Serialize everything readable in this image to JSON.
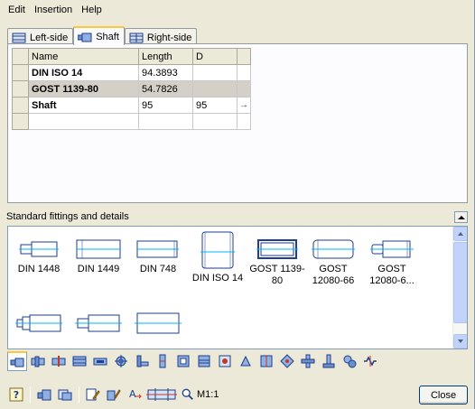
{
  "menu": [
    "Edit",
    "Insertion",
    "Help"
  ],
  "tabs": [
    {
      "label": "Left-side",
      "icon": "left-side-icon",
      "active": false
    },
    {
      "label": "Shaft",
      "icon": "shaft-icon",
      "active": true
    },
    {
      "label": "Right-side",
      "icon": "right-side-icon",
      "active": false
    }
  ],
  "table": {
    "columns": [
      "Name",
      "Length",
      "D"
    ],
    "rows": [
      {
        "name": "DIN ISO 14",
        "length": "94.3893",
        "d": ""
      },
      {
        "name": "GOST 1139-80",
        "length": "54.7826",
        "d": ""
      },
      {
        "name": "Shaft",
        "length": "95",
        "d": "95"
      },
      {
        "name": "",
        "length": "",
        "d": ""
      }
    ],
    "selected_row": 1,
    "row_arrow": "→"
  },
  "fittings": {
    "title": "Standard fittings and details",
    "items": [
      {
        "label": "DIN 1448",
        "icon": "stepped-shaft-icon"
      },
      {
        "label": "DIN 1449",
        "icon": "conical-shaft-icon"
      },
      {
        "label": "DIN 748",
        "icon": "cylinder-shaft-icon"
      },
      {
        "label": "DIN ISO 14",
        "icon": "spline-shaft-icon"
      },
      {
        "label": "GOST 1139-80",
        "icon": "spline-shaft-gost-icon"
      },
      {
        "label": "GOST 12080-66",
        "icon": "shaft-end-gost-icon"
      },
      {
        "label": "GOST 12080-6...",
        "icon": "shaft-end-gost-stepped-icon"
      },
      {
        "label": "",
        "icon": "small-shaft-icon"
      },
      {
        "label": "",
        "icon": "stepped-shaft-small-icon"
      },
      {
        "label": "",
        "icon": "plain-cylinder-icon"
      }
    ]
  },
  "category_toolbar": [
    "shaft-icon",
    "collar-icon",
    "groove-icon",
    "thread-icon",
    "spline-icon",
    "gear-icon",
    "key-icon",
    "chamfer-icon",
    "bearing-icon",
    "seal-icon",
    "housing-icon",
    "retaining-ring-icon",
    "sleeve-icon",
    "cross-icon",
    "coupling-icon",
    "flange-icon",
    "gear-set-icon",
    "spring-icon"
  ],
  "bottom_toolbar": {
    "zoom_label": "M1:1",
    "close_label": "Close"
  },
  "colors": {
    "window_bg": "#ece9d8",
    "selection": "#d4d0c8",
    "accent_tab": "#ffc83c",
    "axis_line": "#00b4ff",
    "icon_blue": "#1f3e8c"
  }
}
